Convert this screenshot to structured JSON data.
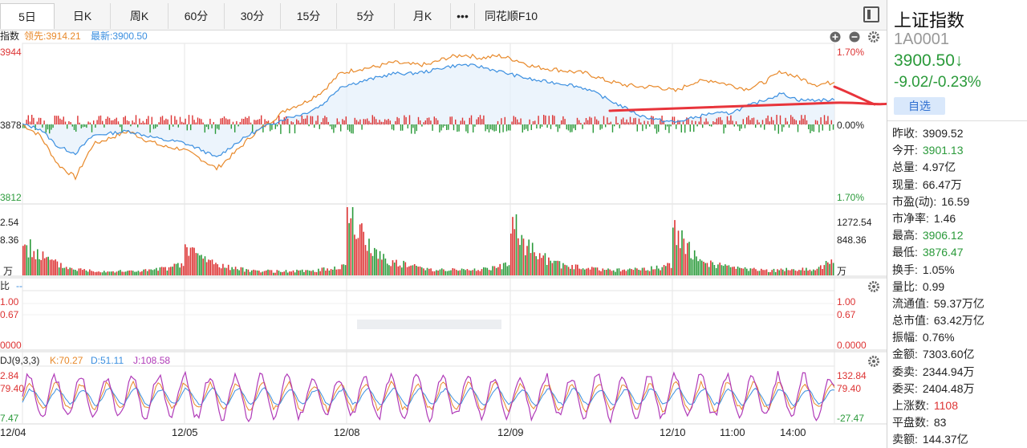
{
  "tabs": [
    {
      "label": "5日",
      "active": true
    },
    {
      "label": "日K"
    },
    {
      "label": "周K"
    },
    {
      "label": "60分"
    },
    {
      "label": "30分"
    },
    {
      "label": "15分"
    },
    {
      "label": "5分"
    },
    {
      "label": "月K"
    },
    {
      "label": "•••"
    },
    {
      "label": "同花顺F10"
    }
  ],
  "quote": {
    "name": "上证指数",
    "code": "1A0001",
    "price": "3900.50↓",
    "change": "-9.02/-0.23%",
    "watch_label": "自选",
    "rows": [
      {
        "label": "昨收:",
        "value": "3909.52",
        "color": ""
      },
      {
        "label": "今开:",
        "value": "3901.13",
        "color": "down"
      },
      {
        "label": "总量:",
        "value": "4.97亿",
        "color": ""
      },
      {
        "label": "现量:",
        "value": "66.47万",
        "color": ""
      },
      {
        "label": "市盈(动):",
        "value": "16.59",
        "color": ""
      },
      {
        "label": "市净率:",
        "value": "1.46",
        "color": ""
      },
      {
        "label": "最高:",
        "value": "3906.12",
        "color": "down"
      },
      {
        "label": "最低:",
        "value": "3876.47",
        "color": "down"
      },
      {
        "label": "换手:",
        "value": "1.05%",
        "color": ""
      },
      {
        "label": "量比:",
        "value": "0.99",
        "color": ""
      },
      {
        "label": "流通值:",
        "value": "59.37万亿",
        "color": ""
      },
      {
        "label": "总市值:",
        "value": "63.42万亿",
        "color": ""
      },
      {
        "label": "振幅:",
        "value": "0.76%",
        "color": ""
      },
      {
        "label": "金额:",
        "value": "7303.60亿",
        "color": ""
      },
      {
        "label": "委卖:",
        "value": "2344.94万",
        "color": ""
      },
      {
        "label": "委买:",
        "value": "2404.48万",
        "color": ""
      },
      {
        "label": "上涨数:",
        "value": "1108",
        "color": "up"
      },
      {
        "label": "平盘数:",
        "value": "83",
        "color": ""
      },
      {
        "label": "卖额:",
        "value": "144.37亿",
        "color": ""
      }
    ]
  },
  "chart_data": [
    {
      "type": "line",
      "panel": "price",
      "header": {
        "label": "指数",
        "lead": "领先:3914.21",
        "latest": "最新:3900.50"
      },
      "y_left_ticks": [
        "3944",
        "3878",
        "3812"
      ],
      "y_right_ticks": [
        "1.70%",
        "0.00%",
        "1.70%"
      ],
      "ylim": [
        3812,
        3944
      ],
      "series": [
        {
          "name": "领先",
          "color": "#e8892a",
          "values": [
            3878,
            3868,
            3842,
            3830,
            3860,
            3866,
            3872,
            3864,
            3858,
            3856,
            3848,
            3838,
            3852,
            3868,
            3880,
            3892,
            3898,
            3908,
            3924,
            3928,
            3930,
            3934,
            3932,
            3932,
            3938,
            3941,
            3938,
            3940,
            3936,
            3930,
            3928,
            3926,
            3924,
            3918,
            3914,
            3912,
            3912,
            3908,
            3916,
            3918,
            3914,
            3910,
            3916,
            3926,
            3920,
            3914,
            3916
          ]
        },
        {
          "name": "最新",
          "color": "#3b8fe0",
          "values": [
            3878,
            3874,
            3858,
            3852,
            3868,
            3870,
            3872,
            3868,
            3864,
            3862,
            3856,
            3848,
            3860,
            3870,
            3878,
            3884,
            3888,
            3896,
            3912,
            3916,
            3920,
            3924,
            3924,
            3926,
            3930,
            3932,
            3930,
            3926,
            3922,
            3918,
            3916,
            3914,
            3910,
            3902,
            3894,
            3886,
            3882,
            3880,
            3884,
            3888,
            3888,
            3894,
            3900,
            3906,
            3900,
            3900,
            3900
          ]
        }
      ],
      "x_labels": [
        "12/04",
        "12/05",
        "12/08",
        "12/09",
        "12/10",
        "11:00",
        "14:00"
      ]
    },
    {
      "type": "bar",
      "panel": "volume",
      "y_left_ticks": [
        "2.54",
        "8.36",
        "万"
      ],
      "y_right_ticks": [
        "1272.54",
        "848.36",
        "万"
      ],
      "ylim": [
        0,
        1272.54
      ],
      "session_values": [
        [
          620,
          420,
          260,
          150,
          110,
          90,
          80,
          80,
          90,
          110,
          150,
          220
        ],
        [
          540,
          380,
          230,
          150,
          110,
          90,
          80,
          80,
          85,
          100,
          140,
          200
        ],
        [
          1250,
          760,
          420,
          280,
          200,
          150,
          120,
          110,
          110,
          120,
          150,
          210
        ],
        [
          1050,
          600,
          360,
          240,
          180,
          140,
          120,
          110,
          110,
          120,
          150,
          220
        ],
        [
          960,
          520,
          300,
          200,
          150,
          120,
          100,
          100,
          110,
          120,
          150,
          300
        ]
      ]
    },
    {
      "type": "line",
      "panel": "volume_ratio",
      "header": {
        "label": "比",
        "value": "--"
      },
      "y_left_ticks": [
        "1.00",
        "0.67",
        "0000"
      ],
      "y_right_ticks": [
        "1.00",
        "0.67",
        "0.0000"
      ],
      "ylim": [
        0,
        1
      ]
    },
    {
      "type": "line",
      "panel": "kdj",
      "header": {
        "label": "DJ(9,3,3)",
        "k": "K:70.27",
        "d": "D:51.11",
        "j": "J:108.58"
      },
      "y_left_ticks": [
        "2.84",
        "79.40",
        "7.47"
      ],
      "y_right_ticks": [
        "132.84",
        "79.40",
        "-27.47"
      ],
      "ylim": [
        -27.47,
        132.84
      ],
      "series": [
        {
          "name": "K",
          "color": "#e8892a"
        },
        {
          "name": "D",
          "color": "#3b8fe0"
        },
        {
          "name": "J",
          "color": "#b03ab8"
        }
      ]
    }
  ],
  "annotation": {
    "color": "#e8343b"
  }
}
